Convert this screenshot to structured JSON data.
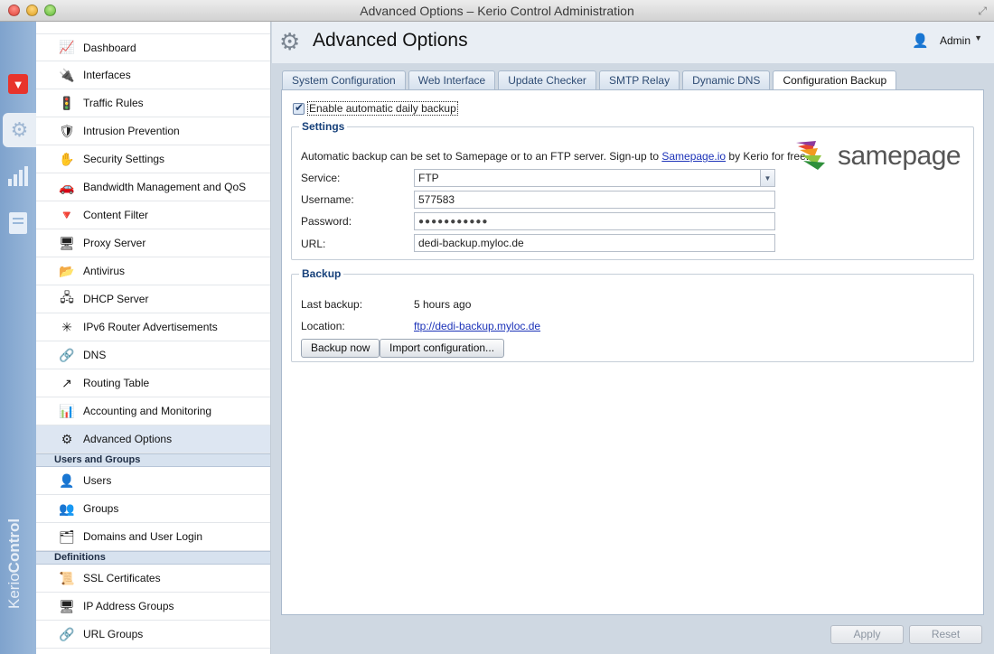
{
  "window": {
    "title": "Advanced Options – Kerio Control Administration"
  },
  "rail": {
    "brand_left": "Kerio",
    "brand_right": "Control",
    "logo_glyph": "▼"
  },
  "sidebar": {
    "items": [
      {
        "label": "Dashboard",
        "icon": "📈"
      },
      {
        "label": "Interfaces",
        "icon": "🔌"
      },
      {
        "label": "Traffic Rules",
        "icon": "🚦"
      },
      {
        "label": "Intrusion Prevention",
        "icon": "🛡"
      },
      {
        "label": "Security Settings",
        "icon": "✋"
      },
      {
        "label": "Bandwidth Management and QoS",
        "icon": "🚗"
      },
      {
        "label": "Content Filter",
        "icon": "🔻"
      },
      {
        "label": "Proxy Server",
        "icon": "🖥"
      },
      {
        "label": "Antivirus",
        "icon": "📂"
      },
      {
        "label": "DHCP Server",
        "icon": "🖧"
      },
      {
        "label": "IPv6 Router Advertisements",
        "icon": "✳"
      },
      {
        "label": "DNS",
        "icon": "🔗"
      },
      {
        "label": "Routing Table",
        "icon": "↗"
      },
      {
        "label": "Accounting and Monitoring",
        "icon": "📊"
      },
      {
        "label": "Advanced Options",
        "icon": "⚙"
      }
    ],
    "group_users": "Users and Groups",
    "users_items": [
      {
        "label": "Users",
        "icon": "👤"
      },
      {
        "label": "Groups",
        "icon": "👥"
      },
      {
        "label": "Domains and User Login",
        "icon": "🗂"
      }
    ],
    "group_definitions": "Definitions",
    "def_items": [
      {
        "label": "SSL Certificates",
        "icon": "📜"
      },
      {
        "label": "IP Address Groups",
        "icon": "🖥"
      },
      {
        "label": "URL Groups",
        "icon": "🔗"
      }
    ]
  },
  "header": {
    "title": "Advanced Options",
    "user": "Admin"
  },
  "tabs": [
    "System Configuration",
    "Web Interface",
    "Update Checker",
    "SMTP Relay",
    "Dynamic DNS",
    "Configuration Backup"
  ],
  "backup_form": {
    "enable_label": "Enable automatic daily backup",
    "settings_legend": "Settings",
    "info_prefix": "Automatic backup can be set to Samepage or to an FTP server. Sign-up to ",
    "info_link": "Samepage.io",
    "info_suffix": " by Kerio for free.",
    "logo_text": "samepage",
    "service_label": "Service:",
    "service_value": "FTP",
    "username_label": "Username:",
    "username_value": "577583",
    "password_label": "Password:",
    "password_value": "●●●●●●●●●●●",
    "url_label": "URL:",
    "url_value": "dedi-backup.myloc.de",
    "backup_legend": "Backup",
    "last_backup_label": "Last backup:",
    "last_backup_value": "5 hours ago",
    "location_label": "Location:",
    "location_value": "ftp://dedi-backup.myloc.de",
    "backup_now": "Backup now",
    "import_config": "Import configuration..."
  },
  "footer": {
    "apply": "Apply",
    "reset": "Reset"
  }
}
